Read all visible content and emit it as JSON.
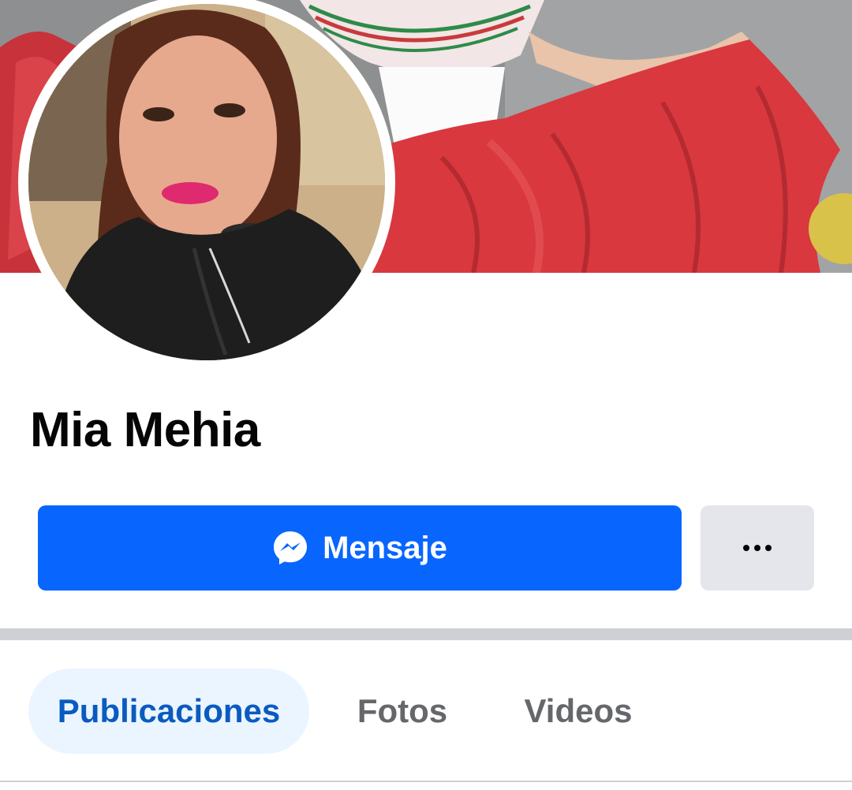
{
  "profile": {
    "name": "Mia Mehia"
  },
  "actions": {
    "message_label": "Mensaje",
    "more_label": "..."
  },
  "tabs": [
    {
      "label": "Publicaciones",
      "active": true
    },
    {
      "label": "Fotos",
      "active": false
    },
    {
      "label": "Videos",
      "active": false
    }
  ],
  "colors": {
    "primary": "#0866ff",
    "secondary_button": "#e4e6eb",
    "active_tab_bg": "#ebf5ff",
    "active_tab_text": "#0a5bc0",
    "inactive_tab_text": "#65676b"
  },
  "icons": {
    "message_button": "messenger-icon",
    "more_button": "more-options-icon"
  }
}
